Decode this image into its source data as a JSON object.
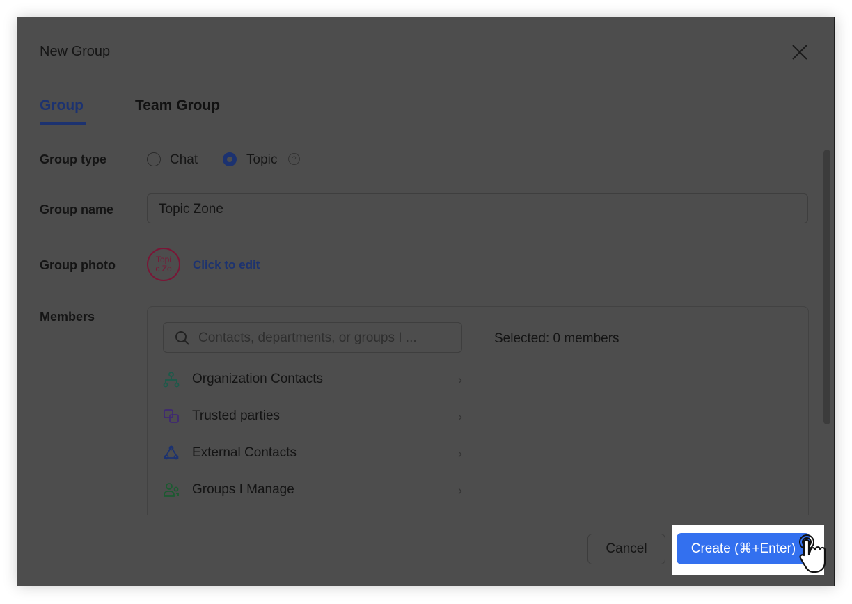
{
  "dialog": {
    "title": "New Group"
  },
  "tabs": [
    {
      "label": "Group",
      "active": true
    },
    {
      "label": "Team Group",
      "active": false
    }
  ],
  "group_type": {
    "label": "Group type",
    "options": [
      {
        "label": "Chat",
        "selected": false
      },
      {
        "label": "Topic",
        "selected": true
      }
    ]
  },
  "group_name": {
    "label": "Group name",
    "value": "Topic Zone"
  },
  "group_photo": {
    "label": "Group photo",
    "avatar_text_line1": "Topi",
    "avatar_text_line2": "c Zo",
    "edit_link": "Click to edit"
  },
  "members": {
    "label": "Members",
    "search_placeholder": "Contacts, departments, or groups I ...",
    "items": [
      {
        "label": "Organization Contacts",
        "icon": "org-chart-icon"
      },
      {
        "label": "Trusted parties",
        "icon": "trusted-parties-icon"
      },
      {
        "label": "External Contacts",
        "icon": "external-contacts-icon"
      },
      {
        "label": "Groups I Manage",
        "icon": "groups-icon"
      }
    ],
    "selected_text": "Selected: 0 members"
  },
  "footer": {
    "cancel": "Cancel",
    "create": "Create (⌘+Enter)"
  },
  "colors": {
    "accent": "#3370ef",
    "overlay": "#4d4d4d"
  }
}
